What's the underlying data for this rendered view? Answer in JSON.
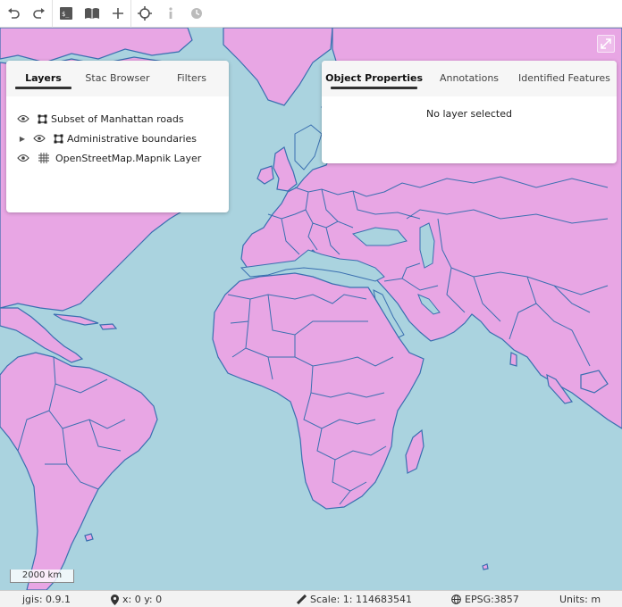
{
  "toolbar": {
    "buttons": [
      "undo-icon",
      "redo-icon",
      "terminal-icon",
      "book-icon",
      "plus-icon",
      "crosshair-icon",
      "info-icon",
      "clock-icon"
    ]
  },
  "left_panel": {
    "tabs": [
      "Layers",
      "Stac Browser",
      "Filters"
    ],
    "active_tab": "Layers",
    "layers": [
      {
        "name": "Subset of Manhattan roads",
        "icon": "vector-layer-icon",
        "expandable": false
      },
      {
        "name": "Administrative boundaries",
        "icon": "vector-layer-icon",
        "expandable": true
      },
      {
        "name": "OpenStreetMap.Mapnik Layer",
        "icon": "raster-layer-icon",
        "expandable": false
      }
    ]
  },
  "right_panel": {
    "tabs": [
      "Object Properties",
      "Annotations",
      "Identified Features"
    ],
    "active_tab": "Object Properties",
    "message": "No layer selected"
  },
  "map": {
    "scale_label": "2000 km",
    "land_color": "#e8a6e4",
    "water_color": "#aad3df",
    "border_color": "#3a6fb0"
  },
  "statusbar": {
    "version": "jgis: 0.9.1",
    "coords": "x: 0 y: 0",
    "scale": "Scale: 1: 114683541",
    "crs": "EPSG:3857",
    "units": "Units: m"
  }
}
